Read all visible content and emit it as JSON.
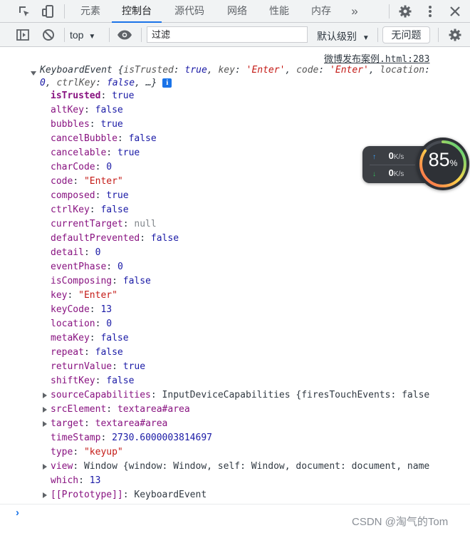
{
  "tabs": [
    {
      "label": "元素",
      "active": false
    },
    {
      "label": "控制台",
      "active": true
    },
    {
      "label": "源代码",
      "active": false
    },
    {
      "label": "网络",
      "active": false
    },
    {
      "label": "性能",
      "active": false
    },
    {
      "label": "内存",
      "active": false
    }
  ],
  "more_tabs_glyph": "»",
  "toolbar": {
    "context": "top",
    "filter_value": "过滤",
    "levels": "默认级别",
    "issues": "无问题"
  },
  "console": {
    "source": "微博发布案例.html:283",
    "summary": {
      "name": "KeyboardEvent",
      "open": "{",
      "parts": [
        {
          "k": "isTrusted",
          "v": "true",
          "t": "bool"
        },
        {
          "k": "key",
          "v": "'Enter'",
          "t": "str"
        },
        {
          "k": "code",
          "v": "'Enter'",
          "t": "str"
        },
        {
          "k": "location",
          "v": "0",
          "t": "num"
        },
        {
          "k": "ctrlKey",
          "v": "false",
          "t": "bool"
        }
      ],
      "tail": "…}"
    },
    "properties": [
      {
        "key": "isTrusted",
        "value": "true",
        "type": "bool",
        "own": true
      },
      {
        "key": "altKey",
        "value": "false",
        "type": "bool"
      },
      {
        "key": "bubbles",
        "value": "true",
        "type": "bool"
      },
      {
        "key": "cancelBubble",
        "value": "false",
        "type": "bool"
      },
      {
        "key": "cancelable",
        "value": "true",
        "type": "bool"
      },
      {
        "key": "charCode",
        "value": "0",
        "type": "num"
      },
      {
        "key": "code",
        "value": "\"Enter\"",
        "type": "str"
      },
      {
        "key": "composed",
        "value": "true",
        "type": "bool"
      },
      {
        "key": "ctrlKey",
        "value": "false",
        "type": "bool"
      },
      {
        "key": "currentTarget",
        "value": "null",
        "type": "null"
      },
      {
        "key": "defaultPrevented",
        "value": "false",
        "type": "bool"
      },
      {
        "key": "detail",
        "value": "0",
        "type": "num"
      },
      {
        "key": "eventPhase",
        "value": "0",
        "type": "num"
      },
      {
        "key": "isComposing",
        "value": "false",
        "type": "bool"
      },
      {
        "key": "key",
        "value": "\"Enter\"",
        "type": "str"
      },
      {
        "key": "keyCode",
        "value": "13",
        "type": "num"
      },
      {
        "key": "location",
        "value": "0",
        "type": "num"
      },
      {
        "key": "metaKey",
        "value": "false",
        "type": "bool"
      },
      {
        "key": "repeat",
        "value": "false",
        "type": "bool"
      },
      {
        "key": "returnValue",
        "value": "true",
        "type": "bool"
      },
      {
        "key": "shiftKey",
        "value": "false",
        "type": "bool"
      },
      {
        "key": "sourceCapabilities",
        "value": "InputDeviceCapabilities {firesTouchEvents: false",
        "type": "obj",
        "expandable": true
      },
      {
        "key": "srcElement",
        "value": "textarea#area",
        "type": "link",
        "expandable": true
      },
      {
        "key": "target",
        "value": "textarea#area",
        "type": "link",
        "expandable": true
      },
      {
        "key": "timeStamp",
        "value": "2730.6000003814697",
        "type": "num"
      },
      {
        "key": "type",
        "value": "\"keyup\"",
        "type": "str"
      },
      {
        "key": "view",
        "value": "Window {window: Window, self: Window, document: document, name",
        "type": "obj",
        "expandable": true
      },
      {
        "key": "which",
        "value": "13",
        "type": "num"
      },
      {
        "key": "[[Prototype]]",
        "value": "KeyboardEvent",
        "type": "obj",
        "expandable": true
      }
    ],
    "prompt": "›"
  },
  "speed_widget": {
    "up_value": "0",
    "up_unit": "K/s",
    "down_value": "0",
    "down_unit": "K/s",
    "gauge_value": "85",
    "gauge_unit": "%",
    "gauge_fraction": 0.85
  },
  "watermark": "CSDN @淘气的Tom",
  "colors": {
    "accent": "#1a73e8",
    "property_key": "#881280",
    "string": "#c41a16",
    "boolean_number": "#1a1aa6"
  }
}
